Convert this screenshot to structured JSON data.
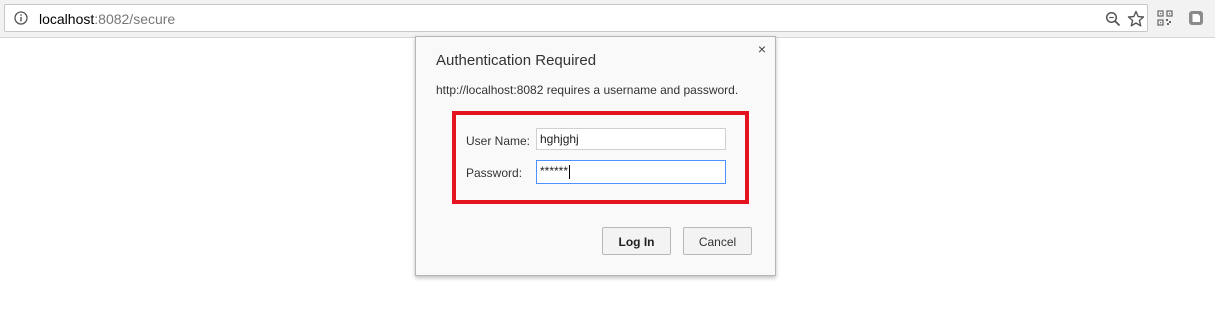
{
  "browser": {
    "url_host": "localhost",
    "url_rest": ":8082/secure",
    "icons": {
      "info": "info-circle-icon",
      "zoom": "zoom-magnifier-icon",
      "bookmark": "star-icon",
      "extension_qr": "qr-code-icon",
      "extension_page": "page-extension-icon"
    }
  },
  "dialog": {
    "title": "Authentication Required",
    "message": "http://localhost:8082 requires a username and password.",
    "close_symbol": "×",
    "username_label": "User Name:",
    "username_value": "hghjghj",
    "password_label": "Password:",
    "password_value": "******",
    "login_label": "Log In",
    "cancel_label": "Cancel",
    "highlight_color": "#e3131f",
    "focus_color": "#4d90fe"
  }
}
